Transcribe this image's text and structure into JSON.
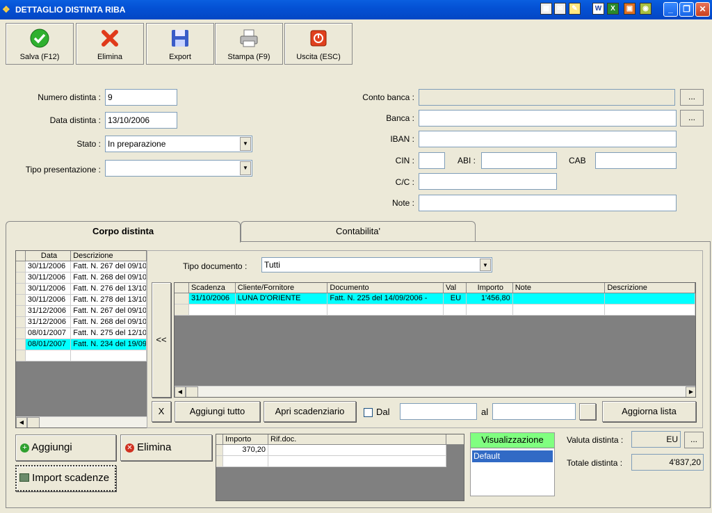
{
  "window": {
    "title": "DETTAGLIO DISTINTA RIBA"
  },
  "toolbar": {
    "save": "Salva (F12)",
    "delete": "Elimina",
    "export": "Export",
    "print": "Stampa (F9)",
    "exit": "Uscita (ESC)"
  },
  "form": {
    "numero_label": "Numero distinta :",
    "numero_value": "9",
    "data_label": "Data distinta :",
    "data_value": "13/10/2006",
    "stato_label": "Stato :",
    "stato_value": "In preparazione",
    "tipo_label": "Tipo presentazione :",
    "tipo_value": "",
    "conto_label": "Conto banca :",
    "banca_label": "Banca :",
    "iban_label": "IBAN :",
    "cin_label": "CIN :",
    "abi_label": "ABI :",
    "cab_label": "CAB",
    "cc_label": "C/C :",
    "note_label": "Note :",
    "ellipsis": "..."
  },
  "tabs": {
    "corpo": "Corpo distinta",
    "contabilita": "Contabilita'"
  },
  "left_grid": {
    "headers": [
      "Data",
      "Descrizione"
    ],
    "rows": [
      [
        "30/11/2006",
        "Fatt. N. 267 del 09/10"
      ],
      [
        "30/11/2006",
        "Fatt. N. 268 del 09/10"
      ],
      [
        "30/11/2006",
        "Fatt. N. 276 del 13/10"
      ],
      [
        "30/11/2006",
        "Fatt. N. 278 del 13/10"
      ],
      [
        "31/12/2006",
        "Fatt. N. 267 del 09/10"
      ],
      [
        "31/12/2006",
        "Fatt. N. 268 del 09/10"
      ],
      [
        "08/01/2007",
        "Fatt. N. 275 del 12/10"
      ],
      [
        "08/01/2007",
        "Fatt. N. 234 del 19/09"
      ]
    ]
  },
  "scad": {
    "tipo_label": "Tipo documento :",
    "tipo_value": "Tutti",
    "move_left": "<<",
    "headers": [
      "Scadenza",
      "Cliente/Fornitore",
      "Documento",
      "Val",
      "Importo",
      "Note",
      "Descrizione"
    ],
    "row": [
      "31/10/2006",
      "LUNA D'ORIENTE",
      "Fatt. N. 225 del 14/09/2006 -",
      "EU",
      "1'456,80",
      "",
      ""
    ],
    "close": "X",
    "aggiungi_tutto": "Aggiungi tutto",
    "apri": "Apri scadenziario",
    "dal": "Dal",
    "al": "al",
    "aggiorna": "Aggiorna lista"
  },
  "bottom": {
    "aggiungi": "Aggiungi",
    "elimina": "Elimina",
    "import": "Import scadenze",
    "imp_headers": [
      "Importo",
      "Rif.doc."
    ],
    "imp_row": [
      "370,20",
      ""
    ],
    "visual_title": "Visualizzazione",
    "visual_item": "Default",
    "valuta_label": "Valuta distinta :",
    "valuta_value": "EU",
    "totale_label": "Totale distinta :",
    "totale_value": "4'837,20"
  },
  "colors": {
    "selection": "#00ffff",
    "visual_header": "#80ff80",
    "list_selected": "#316ac5"
  }
}
